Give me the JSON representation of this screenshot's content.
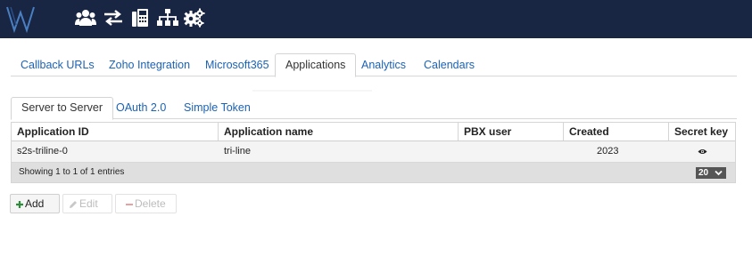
{
  "top_nav": {
    "icons": [
      "logo-w-icon",
      "users-icon",
      "transfer-icon",
      "fax-icon",
      "sitemap-icon",
      "settings-icon"
    ]
  },
  "main_tabs": [
    {
      "label": "Callback URLs"
    },
    {
      "label": "Zoho Integration"
    },
    {
      "label": "Microsoft365"
    },
    {
      "label": "Applications"
    },
    {
      "label": "Analytics"
    },
    {
      "label": "Calendars"
    }
  ],
  "active_main_tab": "Applications",
  "sub_tabs": [
    {
      "label": "Server to Server"
    },
    {
      "label": "OAuth 2.0"
    },
    {
      "label": "Simple Token"
    }
  ],
  "active_sub_tab": "Server to Server",
  "table": {
    "columns": [
      "Application ID",
      "Application name",
      "PBX user",
      "Created",
      "Secret key"
    ],
    "rows": [
      {
        "app_id": "s2s-triline-0",
        "app_name": "tri-line",
        "pbx_user": "",
        "created": "2023",
        "secret_icon": "eye-icon"
      }
    ],
    "footer": "Showing 1 to 1 of 1 entries",
    "page_size": "20"
  },
  "buttons": {
    "add": "Add",
    "edit": "Edit",
    "delete": "Delete"
  },
  "colors": {
    "topbar": "#182543",
    "link": "#1b62b5",
    "add_icon": "#2e8b3d"
  }
}
